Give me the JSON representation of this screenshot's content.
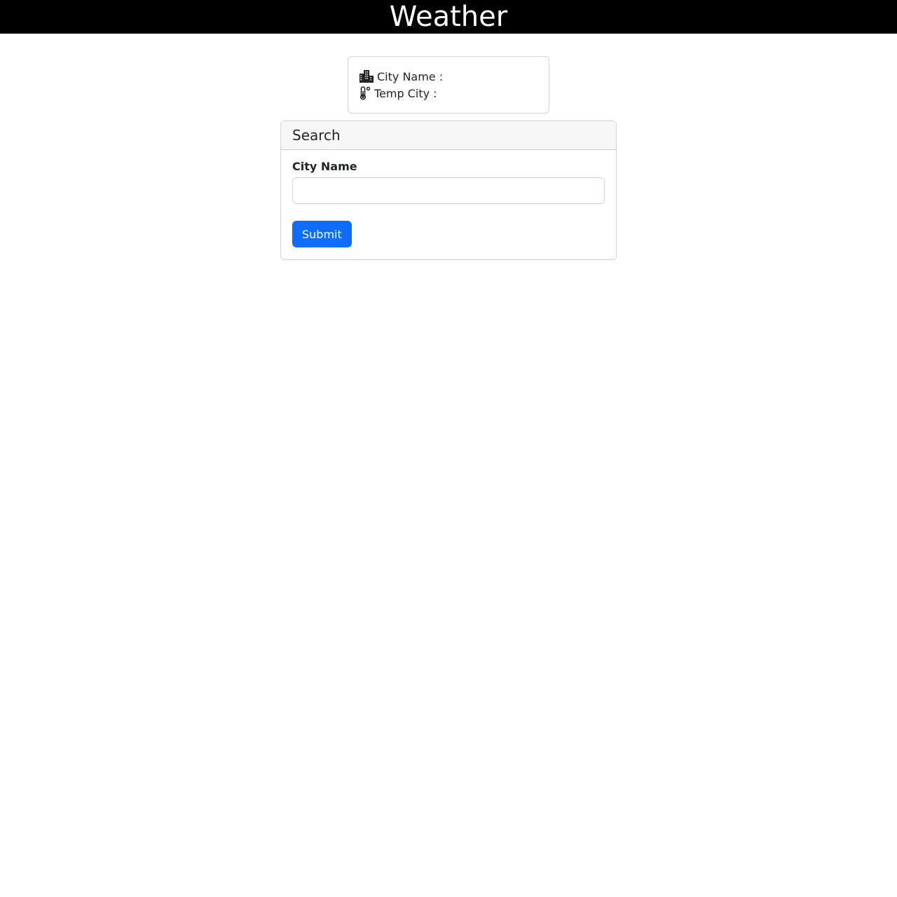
{
  "header": {
    "title": "Weather",
    "background": "#000000"
  },
  "info": {
    "city_label": "City Name :",
    "city_icon": "buildings-icon",
    "temp_label": "Temp City :",
    "temp_icon": "thermometer-icon"
  },
  "search": {
    "title": "Search",
    "field_label": "City Name",
    "input_value": "",
    "input_placeholder": "",
    "submit_label": "Submit",
    "accent": "#0d6efd"
  }
}
